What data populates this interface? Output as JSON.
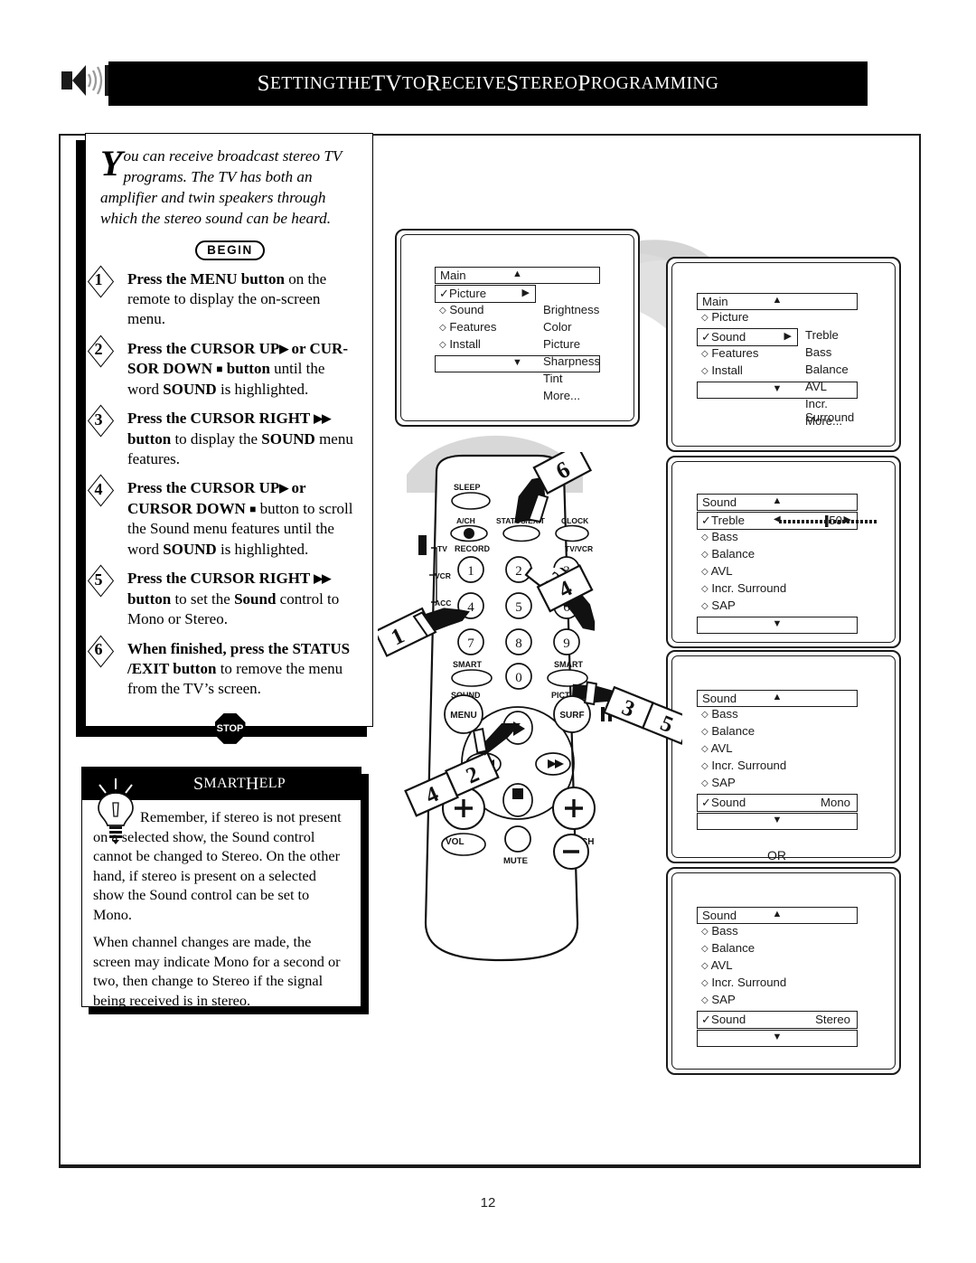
{
  "header": {
    "title_parts": [
      {
        "t": "S",
        "big": true
      },
      {
        "t": "ETTING",
        "big": false
      },
      {
        "t": " ",
        "big": false
      },
      {
        "t": "THE",
        "big": false
      },
      {
        "t": " ",
        "big": false
      },
      {
        "t": "TV",
        "big": true
      },
      {
        "t": " ",
        "big": false
      },
      {
        "t": "TO",
        "big": false
      },
      {
        "t": " ",
        "big": false
      },
      {
        "t": "R",
        "big": true
      },
      {
        "t": "ECEIVE",
        "big": false
      },
      {
        "t": " ",
        "big": false
      },
      {
        "t": "S",
        "big": true
      },
      {
        "t": "TEREO",
        "big": false
      },
      {
        "t": " ",
        "big": false
      },
      {
        "t": "P",
        "big": true
      },
      {
        "t": "ROGRAMMING",
        "big": false
      }
    ],
    "title_plain": "SETTING THE TV TO RECEIVE STEREO PROGRAMMING",
    "icon": "speaker-sound-icon"
  },
  "intro": {
    "dropcap": "Y",
    "text": "ou can receive broadcast stereo TV programs.  The TV has both an amplifier and twin speakers through which the stereo sound can be heard.",
    "begin_label": "BEGIN",
    "stop_label": "STOP"
  },
  "steps": [
    {
      "num": "1",
      "html": "<b>Press the MENU button</b> on the remote to display the on-screen menu."
    },
    {
      "num": "2",
      "html": "<b>Press the CURSOR UP<span class='tri-r'>&#9654;</span> or CUR-SOR DOWN <span class='sq'>&#9632;</span> button</b> until the word <b>SOUND</b> is highlighted."
    },
    {
      "num": "3",
      "html": "<b>Press the CURSOR RIGHT <span class='tri-r'>&#9654;&#9654;</span><br>button</b> to display the <b>SOUND</b> menu features."
    },
    {
      "num": "4",
      "html": "<b>Press the CURSOR UP<span class='tri-r'>&#9654;</span> or<br>CURSOR DOWN <span class='sq'>&#9632;</span></b> button to scroll the Sound menu features until the word <b>SOUND</b> is highlighted."
    },
    {
      "num": "5",
      "html": "<b>Press the CURSOR RIGHT <span class='tri-r'>&#9654;&#9654;</span><br>button</b> to set the <b>Sound</b> control to Mono or Stereo."
    },
    {
      "num": "6",
      "html": "<b>When finished, press the STATUS /EXIT button</b> to remove the menu from the TV&rsquo;s screen."
    }
  ],
  "smart_help": {
    "title_parts": [
      {
        "t": "S",
        "big": true
      },
      {
        "t": "MART",
        "big": false
      },
      {
        "t": " ",
        "big": false
      },
      {
        "t": "H",
        "big": true
      },
      {
        "t": "ELP",
        "big": false
      }
    ],
    "title_plain": "SMART HELP",
    "icon": "lightbulb-icon",
    "paragraphs": [
      "Remember, if stereo is not present on a selected show, the Sound control cannot be changed to Stereo. On the other hand, if stereo is present on a selected show the Sound control can be set to Mono.",
      "When channel changes are made, the screen may indicate Mono for a second or two, then change to Stereo if the signal being received is in stereo."
    ]
  },
  "osd_screens": [
    {
      "id": "main-picture",
      "header": {
        "label": "Main",
        "up_arrow": "▲"
      },
      "left_items": [
        {
          "label": "Picture",
          "marker": "✓",
          "selected": true,
          "right_arrow": "▶"
        },
        {
          "label": "Sound",
          "marker": "◇",
          "selected": false
        },
        {
          "label": "Features",
          "marker": "◇",
          "selected": false
        },
        {
          "label": "Install",
          "marker": "◇",
          "selected": false
        }
      ],
      "right_items": [
        "Brightness",
        "Color",
        "Picture",
        "Sharpness",
        "Tint",
        "More..."
      ],
      "footer": {
        "down_arrow": "▼"
      }
    },
    {
      "id": "main-sound",
      "header": {
        "label": "Main",
        "up_arrow": "▲"
      },
      "left_items": [
        {
          "label": "Picture",
          "marker": "◇",
          "selected": false
        },
        {
          "label": "Sound",
          "marker": "✓",
          "selected": true,
          "right_arrow": "▶"
        },
        {
          "label": "Features",
          "marker": "◇",
          "selected": false
        },
        {
          "label": "Install",
          "marker": "◇",
          "selected": false
        }
      ],
      "right_items": [
        "Treble",
        "Bass",
        "Balance",
        "AVL",
        "Incr. Surround",
        "More..."
      ],
      "footer": {
        "down_arrow": "▼"
      }
    },
    {
      "id": "sound-treble",
      "header": {
        "label": "Sound",
        "up_arrow": "▲"
      },
      "left_items": [
        {
          "label": "Treble",
          "marker": "✓",
          "selected": true,
          "slider_value": "50",
          "left_arrow": "◀",
          "right_arrow": "▶"
        },
        {
          "label": "Bass",
          "marker": "◇",
          "selected": false
        },
        {
          "label": "Balance",
          "marker": "◇",
          "selected": false
        },
        {
          "label": "AVL",
          "marker": "◇",
          "selected": false
        },
        {
          "label": "Incr. Surround",
          "marker": "◇",
          "selected": false
        },
        {
          "label": "SAP",
          "marker": "◇",
          "selected": false
        }
      ],
      "footer": {
        "down_arrow": "▼"
      }
    },
    {
      "id": "sound-mono",
      "header": {
        "label": "Sound",
        "up_arrow": "▲"
      },
      "left_items": [
        {
          "label": "Bass",
          "marker": "◇",
          "selected": false
        },
        {
          "label": "Balance",
          "marker": "◇",
          "selected": false
        },
        {
          "label": "AVL",
          "marker": "◇",
          "selected": false
        },
        {
          "label": "Incr. Surround",
          "marker": "◇",
          "selected": false
        },
        {
          "label": "SAP",
          "marker": "◇",
          "selected": false
        },
        {
          "label": "Sound",
          "marker": "✓",
          "selected": true,
          "value": "Mono"
        }
      ],
      "footer": {
        "down_arrow": "▼"
      }
    },
    {
      "id": "sound-stereo",
      "header": {
        "label": "Sound",
        "up_arrow": "▲"
      },
      "left_items": [
        {
          "label": "Bass",
          "marker": "◇",
          "selected": false
        },
        {
          "label": "Balance",
          "marker": "◇",
          "selected": false
        },
        {
          "label": "AVL",
          "marker": "◇",
          "selected": false
        },
        {
          "label": "Incr. Surround",
          "marker": "◇",
          "selected": false
        },
        {
          "label": "SAP",
          "marker": "◇",
          "selected": false
        },
        {
          "label": "Sound",
          "marker": "✓",
          "selected": true,
          "value": "Stereo"
        }
      ],
      "footer": {
        "down_arrow": "▼"
      }
    }
  ],
  "or_label": "OR",
  "remote": {
    "labels": {
      "sleep": "SLEEP",
      "ach": "A/CH",
      "status_exit": "STATUS/EXIT",
      "clock": "CLOCK",
      "record": "RECORD",
      "tvvcr": "TV/VCR",
      "tv": "TV",
      "vcr": "VCR",
      "acc": "ACC",
      "smart": "SMART",
      "picture": "PICTURE",
      "sound": "SOUND",
      "menu": "MENU",
      "surf": "SURF",
      "vol": "VOL",
      "ch": "CH",
      "mute": "MUTE"
    },
    "keypad": [
      "1",
      "2",
      "3",
      "4",
      "5",
      "6",
      "7",
      "8",
      "9",
      "0"
    ],
    "callouts": [
      "1",
      "2",
      "3",
      "4",
      "5",
      "6",
      "2",
      "4"
    ]
  },
  "page_number": "12"
}
